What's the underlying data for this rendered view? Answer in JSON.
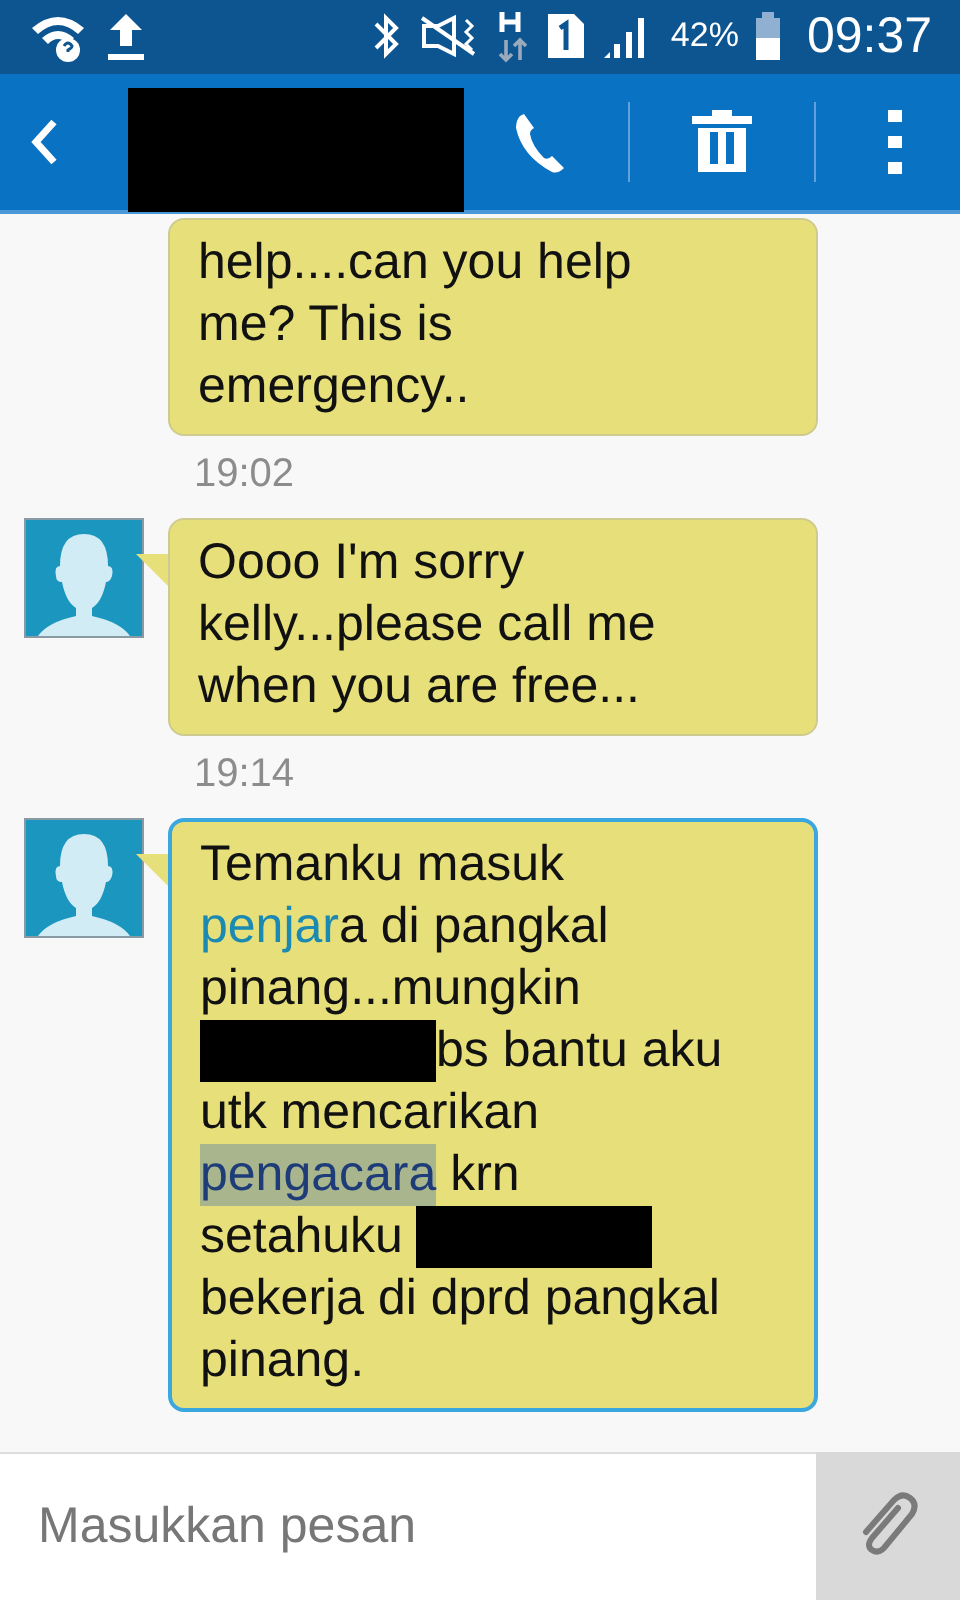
{
  "status_bar": {
    "battery_text": "42%",
    "time": "09:37"
  },
  "header": {
    "contact": {
      "kind": "redacted"
    }
  },
  "messages": [
    {
      "avatar": false,
      "selected": false,
      "lines": [
        [
          {
            "kind": "text",
            "text": "help....can you help"
          }
        ],
        [
          {
            "kind": "text",
            "text": "me? This is"
          }
        ],
        [
          {
            "kind": "text",
            "text": "emergency.."
          }
        ]
      ],
      "time": "19:02"
    },
    {
      "avatar": true,
      "selected": false,
      "lines": [
        [
          {
            "kind": "text",
            "text": "Oooo I'm sorry"
          }
        ],
        [
          {
            "kind": "text",
            "text": "kelly...please call me"
          }
        ],
        [
          {
            "kind": "text",
            "text": "when you are free..."
          }
        ]
      ],
      "time": "19:14"
    },
    {
      "avatar": true,
      "selected": true,
      "lines": [
        [
          {
            "kind": "text",
            "text": "Temanku masuk"
          }
        ],
        [
          {
            "kind": "link",
            "text": "penjar"
          },
          {
            "kind": "text",
            "text": "a di pangkal"
          }
        ],
        [
          {
            "kind": "text",
            "text": "pinang...mungkin"
          }
        ],
        [
          {
            "kind": "redacted"
          },
          {
            "kind": "text",
            "text": "bs bantu aku"
          }
        ],
        [
          {
            "kind": "text",
            "text": "utk mencarikan"
          }
        ],
        [
          {
            "kind": "highlight",
            "text": "pengacara"
          },
          {
            "kind": "text",
            "text": " krn"
          }
        ],
        [
          {
            "kind": "text",
            "text": "setahuku "
          },
          {
            "kind": "redacted"
          }
        ],
        [
          {
            "kind": "text",
            "text": "bekerja di dprd pangkal"
          }
        ],
        [
          {
            "kind": "text",
            "text": "pinang."
          }
        ]
      ]
    }
  ],
  "composer": {
    "placeholder": "Masukkan pesan"
  }
}
